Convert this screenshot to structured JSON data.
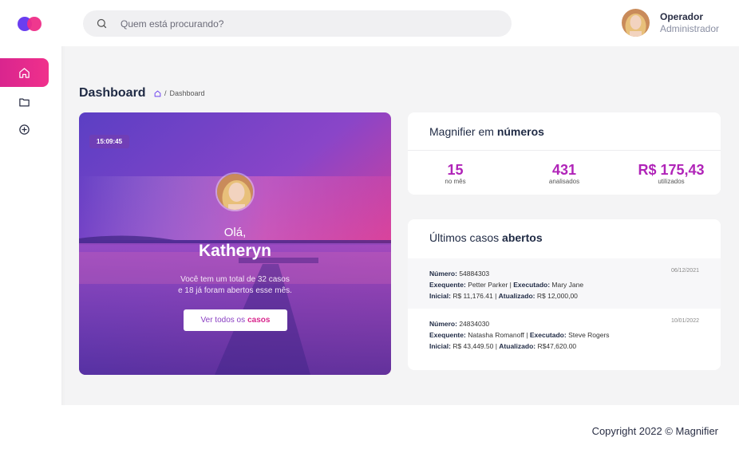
{
  "sidebar": {
    "items": [
      {
        "name": "home",
        "icon": "home-icon",
        "active": true
      },
      {
        "name": "folder",
        "icon": "folder-icon",
        "active": false
      },
      {
        "name": "add",
        "icon": "plus-circle-icon",
        "active": false
      }
    ]
  },
  "header": {
    "search_placeholder": "Quem está procurando?",
    "user": {
      "name": "Operador",
      "role": "Administrador"
    }
  },
  "page": {
    "title": "Dashboard",
    "breadcrumb": [
      "Dashboard"
    ]
  },
  "hero": {
    "time": "15:09:45",
    "greeting": "Olá,",
    "name": "Katheryn",
    "text_line1": "Você tem um total de 32 casos",
    "text_line2": "e 18 já foram abertos esse mês.",
    "button_prefix": "Ver todos os",
    "button_emphasis": "casos"
  },
  "numbers": {
    "title_prefix": "Magnifier em",
    "title_emphasis": "números",
    "stats": [
      {
        "value": "15",
        "label": "no mês"
      },
      {
        "value": "431",
        "label": "analisados"
      },
      {
        "value": "R$ 175,43",
        "label": "utilizados"
      }
    ]
  },
  "cases": {
    "title_prefix": "Últimos casos",
    "title_emphasis": "abertos",
    "labels": {
      "numero": "Número:",
      "exequente": "Exequente:",
      "executado": "Executado:",
      "inicial": "Inicial:",
      "atualizado": "Atualizado:"
    },
    "items": [
      {
        "numero": "54884303",
        "exequente": "Petter Parker",
        "executado": "Mary Jane",
        "inicial": "R$ 11,176.41",
        "atualizado": "R$ 12,000,00",
        "date": "06/12/2021"
      },
      {
        "numero": "24834030",
        "exequente": "Natasha Romanoff",
        "executado": "Steve Rogers",
        "inicial": "R$ 43,449.50",
        "atualizado": "R$47,620.00",
        "date": "10/01/2022"
      }
    ]
  },
  "footer": {
    "copyright": "Copyright 2022 © Magnifier"
  },
  "colors": {
    "accent": "#d8258c",
    "purple": "#b024b8",
    "logo_blue": "#6a3ef0",
    "logo_pink": "#ee2d88"
  }
}
